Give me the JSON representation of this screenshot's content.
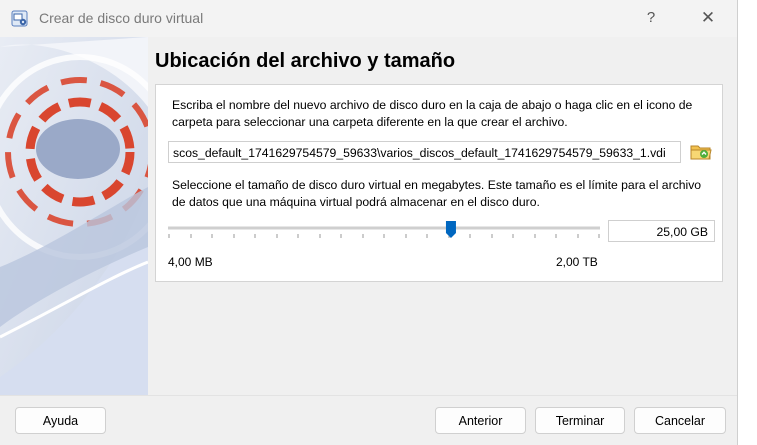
{
  "window": {
    "title": "Crear de disco duro virtual",
    "help_glyph": "?",
    "close_glyph": "✕"
  },
  "page": {
    "heading": "Ubicación del archivo y tamaño"
  },
  "location": {
    "description": "Escriba el nombre del nuevo archivo de disco duro en la caja de abajo o haga clic en el icono de carpeta para seleccionar una carpeta diferente en la que crear el archivo.",
    "path_value": "scos_default_1741629754579_59633\\varios_discos_default_1741629754579_59633_1.vdi",
    "folder_icon": "folder-icon"
  },
  "size": {
    "description": "Seleccione el tamaño de disco duro virtual en megabytes. Este tamaño es el límite para el archivo de datos que una máquina virtual podrá almacenar en el disco duro.",
    "value": "25,00 GB",
    "slider_position": 0.655,
    "min_label": "4,00 MB",
    "max_label": "2,00 TB"
  },
  "buttons": {
    "help": "Ayuda",
    "back": "Anterior",
    "finish": "Terminar",
    "cancel": "Cancelar"
  },
  "colors": {
    "accent": "#0067c0",
    "art_red": "#d9462f",
    "art_blue": "#9aa9c8"
  }
}
